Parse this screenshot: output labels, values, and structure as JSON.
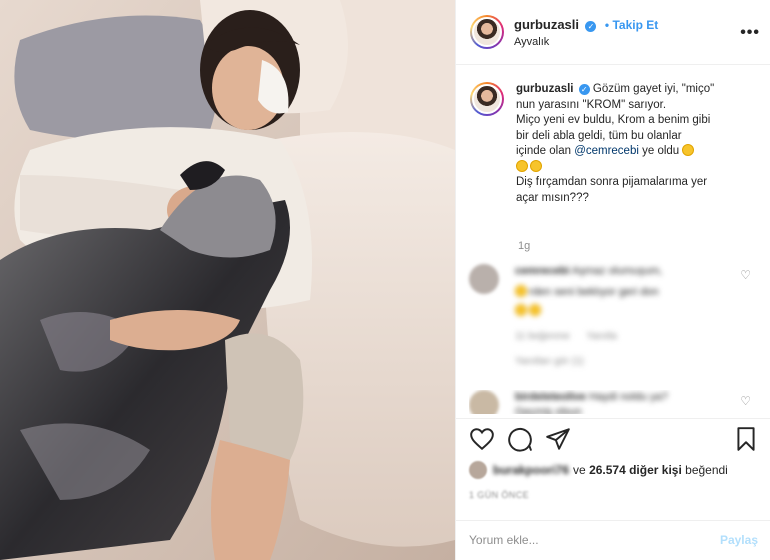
{
  "post": {
    "username": "gurbuzasli",
    "follow_label": "Takip Et",
    "location": "Ayvalık",
    "more_label": "•••",
    "verified_glyph": "✓",
    "caption_lines": [
      "Gözüm gayet iyi, \"miço\"",
      "nun yarasını \"KROM\" sarıyor.",
      "Miço yeni ev buldu, Krom a benim gibi",
      "bir deli abla geldi, tüm bu olanlar",
      "içinde olan "
    ],
    "caption_mention": "@cemrecebi",
    "caption_mention_suffix": " ye oldu",
    "caption_lines_after": [
      "Diş fırçamdan sonra pijamalarıma yer",
      "açar mısın???"
    ],
    "time_ago": "1g"
  },
  "comments": [
    {
      "user": "cemrecebi",
      "text": "Aşmaz olumuşum,",
      "text2": "rden seni beklıyor geri don",
      "meta1": "11 beğenme",
      "meta2": "Yanıtla",
      "replies": "Yanıtları gör (1)"
    },
    {
      "user": "birdeleteolive",
      "text": "Haydi noldu ya?",
      "text2": "Geçmiş olsun"
    }
  ],
  "likes": {
    "first_user": "burakpoori76",
    "connector": "ve",
    "count": "26.574 diğer kişi",
    "suffix": "beğendi"
  },
  "posted_label": "1 GÜN ÖNCE",
  "comment_box": {
    "placeholder": "Yorum ekle...",
    "share_label": "Paylaş"
  },
  "icons": [
    "heart-icon",
    "comment-icon",
    "share-icon",
    "bookmark-icon"
  ],
  "colors": {
    "accent": "#3897f0",
    "text": "#262626",
    "muted": "#8e8e8e",
    "share_disabled": "#b2dffc"
  }
}
